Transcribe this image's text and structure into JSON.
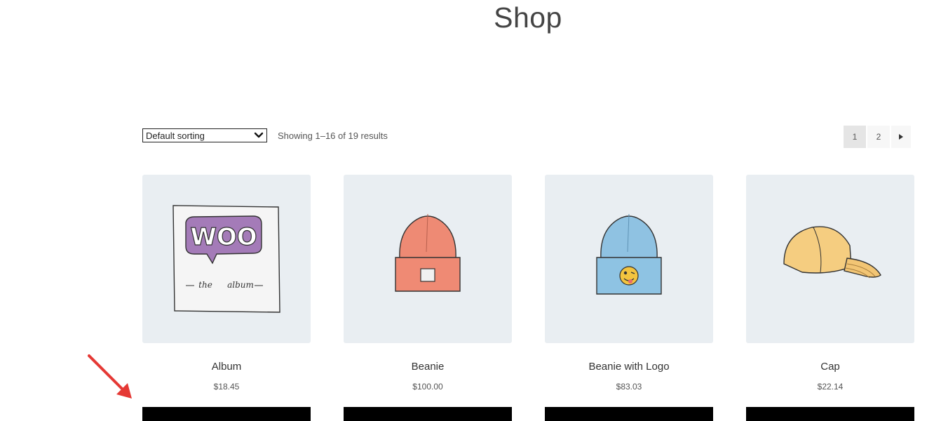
{
  "page": {
    "title": "Shop"
  },
  "toolbar": {
    "sort_value": "Default sorting",
    "result_count": "Showing 1–16 of 19 results"
  },
  "pagination": {
    "page1": "1",
    "page2": "2",
    "next_icon": "triangle-right-icon"
  },
  "products": [
    {
      "name": "Album",
      "price": "$18.45",
      "image": "woo-album-image"
    },
    {
      "name": "Beanie",
      "price": "$100.00",
      "image": "orange-beanie-image"
    },
    {
      "name": "Beanie with Logo",
      "price": "$83.03",
      "image": "blue-beanie-logo-image"
    },
    {
      "name": "Cap",
      "price": "$22.14",
      "image": "yellow-cap-image"
    }
  ],
  "colors": {
    "card_bg": "#e9eef2",
    "button_bg": "#000000",
    "annotation_arrow": "#e53935"
  }
}
